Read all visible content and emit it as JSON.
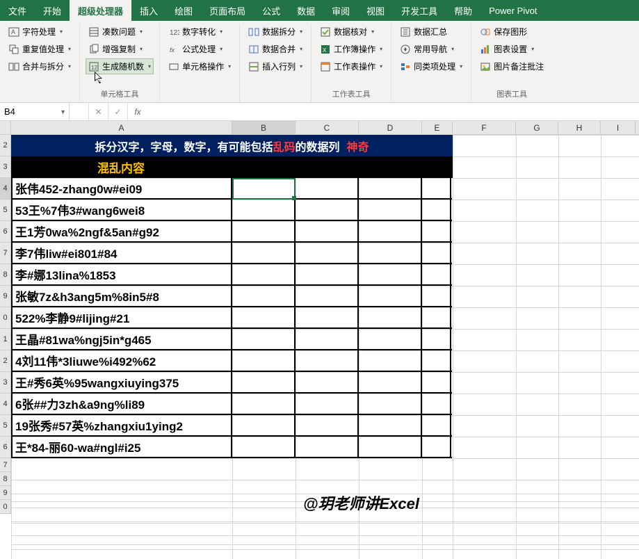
{
  "tabs": [
    "文件",
    "开始",
    "超级处理器",
    "插入",
    "绘图",
    "页面布局",
    "公式",
    "数据",
    "审阅",
    "视图",
    "开发工具",
    "帮助",
    "Power Pivot"
  ],
  "active_tab_index": 2,
  "ribbon": {
    "g1": {
      "items": [
        "字符处理",
        "重复值处理",
        "合并与拆分"
      ],
      "label": ""
    },
    "g2": {
      "items": [
        "凑数问题",
        "增强复制",
        "生成随机数"
      ],
      "label": "单元格工具"
    },
    "g3": {
      "items": [
        "数字转化",
        "公式处理",
        "单元格操作"
      ],
      "label": ""
    },
    "g4": {
      "items": [
        "数据拆分",
        "数据合并",
        "插入行列"
      ],
      "label": ""
    },
    "g5": {
      "items": [
        "数据核对",
        "工作簿操作",
        "工作表操作"
      ],
      "label": "工作表工具"
    },
    "g6": {
      "items": [
        "数据汇总",
        "常用导航",
        "同类项处理"
      ],
      "label": ""
    },
    "g7": {
      "items": [
        "保存图形",
        "图表设置",
        "图片备注批注"
      ],
      "label": "图表工具"
    }
  },
  "name_box": "B4",
  "columns": [
    "A",
    "B",
    "C",
    "D",
    "E",
    "F",
    "G",
    "H",
    "I"
  ],
  "banner": {
    "p1": "拆分汉字，字母，数字，有可能包括",
    "p2": "乱码",
    "p3": "的数据列",
    "p4": "神奇"
  },
  "header_row": {
    "A": "混乱内容"
  },
  "data": [
    "张伟452-zhang0w#ei09",
    "53王%7伟3#wang6wei8",
    "王1芳0wa%2ngf&5an#g92",
    "李7伟liw#ei801#84",
    "李#娜13lina%1853",
    "张敏7z&h3ang5m%8in5#8",
    "522%李静9#lijing#21",
    "王晶#81wa%ngj5in*g465",
    "4刘11伟*3liuwe%i492%62",
    "王#秀6英%95wangxiuying375",
    "6张##力3zh&a9ng%li89",
    "19张秀#57英%zhangxiu1ying2",
    "王*84-丽60-wa#ngl#i25"
  ],
  "row_numbers_visible": [
    "2",
    "3",
    "4",
    "5",
    "6",
    "7",
    "8",
    "9",
    "0",
    "1",
    "2",
    "3",
    "4",
    "5",
    "6",
    "7",
    "8",
    "9",
    "0"
  ],
  "watermark": "@玥老师讲Excel"
}
